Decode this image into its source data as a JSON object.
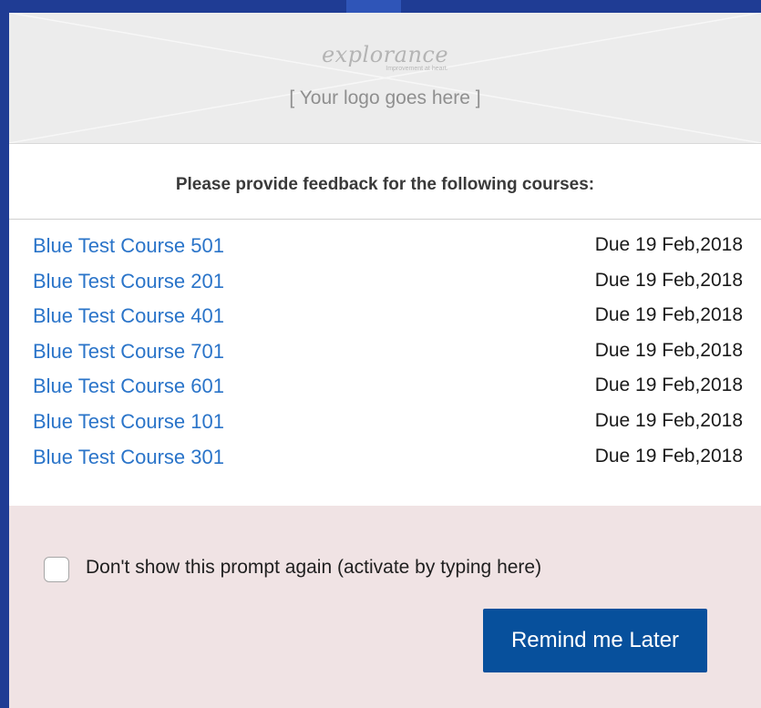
{
  "logo": {
    "wordmark": "explorance",
    "tagline": "Improvement at heart.",
    "placeholder": "[ Your logo goes here ]"
  },
  "prompt": {
    "heading": "Please provide feedback for the following courses:"
  },
  "courses": [
    {
      "name": "Blue Test Course 501",
      "due": "Due 19 Feb,2018"
    },
    {
      "name": "Blue Test Course 201",
      "due": "Due 19 Feb,2018"
    },
    {
      "name": "Blue Test Course 401",
      "due": "Due 19 Feb,2018"
    },
    {
      "name": "Blue Test Course 701",
      "due": "Due 19 Feb,2018"
    },
    {
      "name": "Blue Test Course 601",
      "due": "Due 19 Feb,2018"
    },
    {
      "name": "Blue Test Course 101",
      "due": "Due 19 Feb,2018"
    },
    {
      "name": "Blue Test Course 301",
      "due": "Due 19 Feb,2018"
    }
  ],
  "footer": {
    "checkbox_label": "Don't show this prompt again (activate by typing here)",
    "checkbox_checked": false,
    "remind_button_label": "Remind me Later"
  },
  "colors": {
    "link": "#2a74c9",
    "button": "#07509c",
    "footer_bg": "#f0e3e4",
    "backdrop": "#1f3c94"
  }
}
